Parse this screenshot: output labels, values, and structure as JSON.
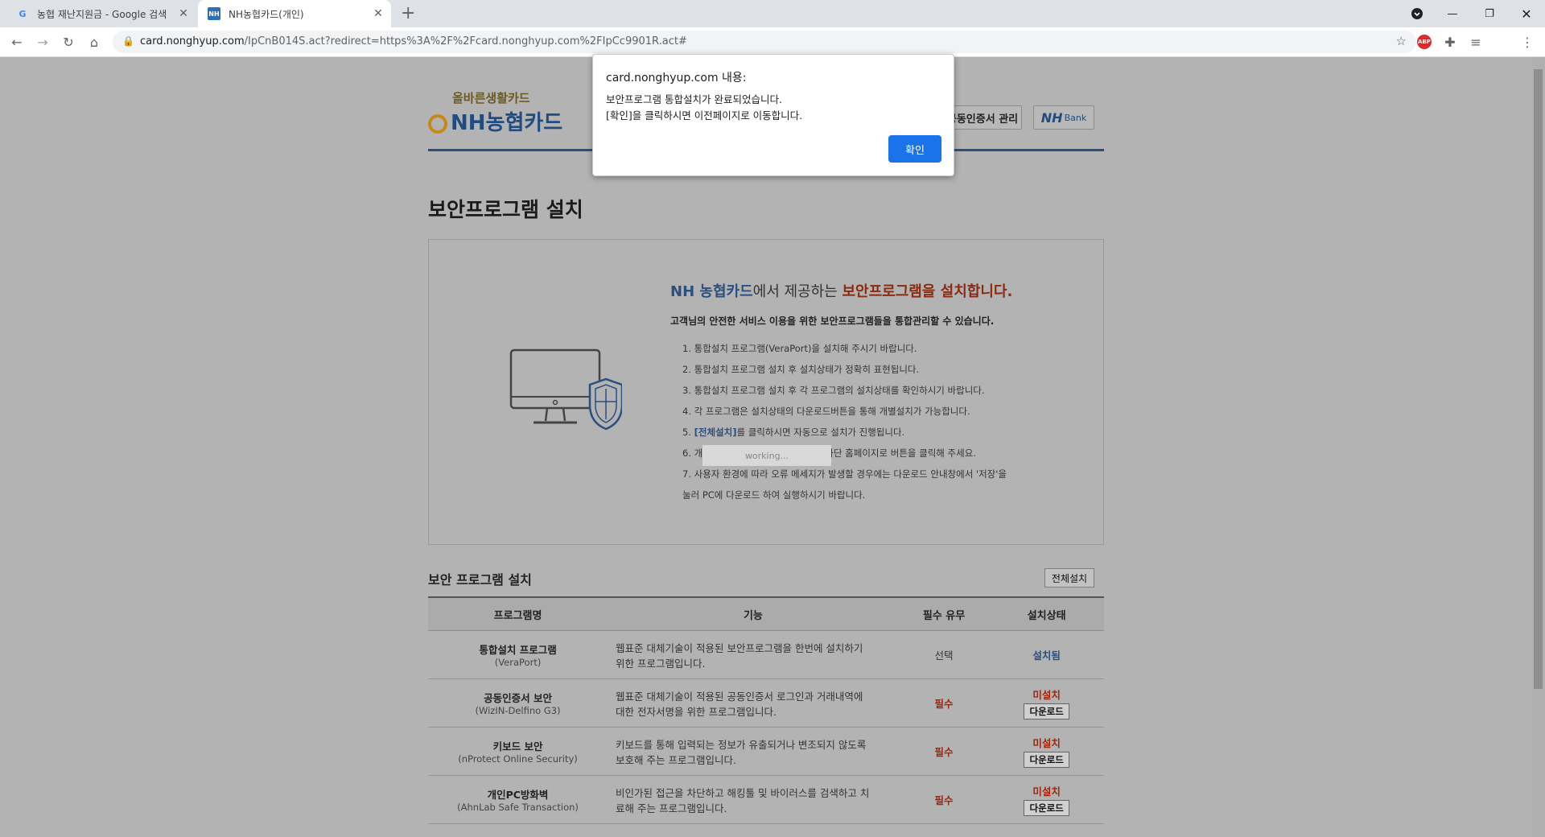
{
  "tabs": [
    {
      "title": "농협 재난지원금 - Google 검색",
      "favicon": "G",
      "active": false
    },
    {
      "title": "NH농협카드(개인)",
      "favicon": "NH",
      "active": true
    }
  ],
  "address_bar": {
    "host": "card.nonghyup.com",
    "path": "/IpCnB014S.act?redirect=https%3A%2F%2Fcard.nonghyup.com%2FIpCc9901R.act#"
  },
  "header": {
    "logo_tag": "올바른생활카드",
    "logo_brand": "NH농협카드",
    "cert_button": "공동인증서 관리",
    "bank_button_nh": "NH",
    "bank_button_bank": "Bank"
  },
  "page_title": "보안프로그램 설치",
  "intro": {
    "headline_brand": "NH 농협카드",
    "headline_middle": "에서 제공하는 ",
    "headline_action": "보안프로그램을 설치합니다.",
    "subline": "고객님의 안전한 서비스 이용을 위한 보안프로그램들을 통합관리할 수 있습니다.",
    "step1": "1. 통합설치 프로그램(VeraPort)을 설치해 주시기 바랍니다.",
    "step2": "2. 통합설치 프로그램 설치 후 설치상태가 정확히 표현됩니다.",
    "step3": "3. 통합설치 프로그램 설치 후 각 프로그램의 설치상태를 확인하시기 바랍니다.",
    "step4": "4. 각 프로그램은 설치상태의 다운로드버튼을 통해 개별설치가 가능합니다.",
    "step5_prefix": "5. ",
    "step5_link": "[전체설치]",
    "step5_suffix": "를 클릭하시면 자동으로 설치가 진행됩니다.",
    "step6": "6. 개별로 프로그램을 설치한 후에는 하단 홈페이지로 버튼을 클릭해 주세요.",
    "step7_line1": "7. 사용자 환경에 따라 오류 메세지가 발생할 경우에는 다운로드 안내창에서 '저장'을",
    "step7_line2": "눌러 PC에 다운로드 하여 실행하시기 바랍니다.",
    "working_text": "working..."
  },
  "install_section": {
    "title": "보안 프로그램 설치",
    "install_all_button": "전체설치",
    "columns": [
      "프로그램명",
      "기능",
      "필수 유무",
      "설치상태"
    ],
    "rows": [
      {
        "name": "통합설치 프로그램",
        "sub": "(VeraPort)",
        "desc1": "웹표준 대체기술이 적용된 보안프로그램을 한번에 설치하기",
        "desc2": "위한 프로그램입니다.",
        "required": "선택",
        "status": "설치됨",
        "download": ""
      },
      {
        "name": "공동인증서 보안",
        "sub": "(WizIN-Delfino G3)",
        "desc1": "웹표준 대체기술이 적용된 공동인증서 로그인과 거래내역에",
        "desc2": "대한 전자서명을 위한 프로그램입니다.",
        "required": "필수",
        "status": "미설치",
        "download": "다운로드"
      },
      {
        "name": "키보드 보안",
        "sub": "(nProtect Online Security)",
        "desc1": "키보드를 통해 입력되는 정보가 유출되거나 변조되지 않도록",
        "desc2": "보호해 주는 프로그램입니다.",
        "required": "필수",
        "status": "미설치",
        "download": "다운로드"
      },
      {
        "name": "개인PC방화벽",
        "sub": "(AhnLab Safe Transaction)",
        "desc1": "비인가된 접근을 차단하고 해킹툴 및 바이러스를 검색하고 치",
        "desc2": "료해 주는 프로그램입니다.",
        "required": "필수",
        "status": "미설치",
        "download": "다운로드"
      }
    ]
  },
  "dialog": {
    "origin": "card.nonghyup.com 내용:",
    "line1": "보안프로그램 통합설치가 완료되었습니다.",
    "line2": "[확인]을 클릭하시면 이전페이지로 이동합니다.",
    "ok_button": "확인"
  },
  "extensions": {
    "abp_label": "ABP"
  },
  "colors": {
    "brand_blue": "#2b4f7f",
    "accent_red": "#a3250c",
    "dialog_button": "#1a73e8"
  }
}
